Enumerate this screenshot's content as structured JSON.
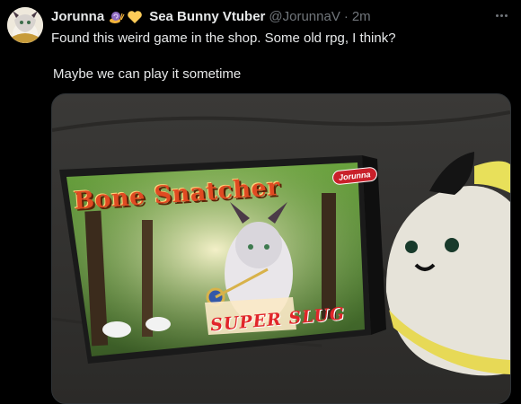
{
  "tweet": {
    "display_name_1": "Jorunna",
    "display_name_2": "Sea Bunny Vtuber",
    "handle": "@JorunnaV",
    "separator": "·",
    "timestamp": "2m",
    "text_line_1": "Found this weird game in the shop. Some old rpg, I think?",
    "text_line_2": "Maybe we can play it sometime",
    "emojis": [
      "snail-emoji",
      "yellow-heart-emoji"
    ]
  },
  "media": {
    "box_title": "Bone Snatcher",
    "brand_badge": "Jorunna",
    "console_logo": "SUPER SLUG"
  },
  "colors": {
    "background": "#000000",
    "text_primary": "#e7e9ea",
    "text_secondary": "#71767b",
    "border": "#2f3336"
  }
}
